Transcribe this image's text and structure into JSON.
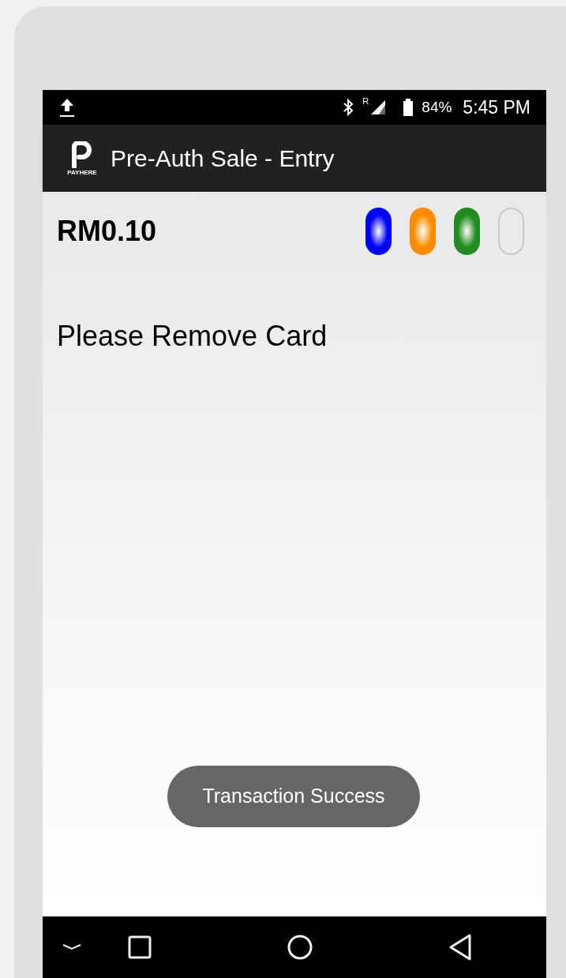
{
  "status_bar": {
    "battery": "84%",
    "time": "5:45 PM",
    "signal_label": "R"
  },
  "app_bar": {
    "logo_text": "PAYHERE",
    "title": "Pre-Auth Sale - Entry"
  },
  "amount": "RM0.10",
  "indicators": [
    {
      "on": true,
      "color": "#0000ff"
    },
    {
      "on": true,
      "color": "#ff8c00"
    },
    {
      "on": true,
      "color": "#1e8c1e"
    },
    {
      "on": false
    }
  ],
  "message": "Please Remove Card",
  "toast": "Transaction Success"
}
